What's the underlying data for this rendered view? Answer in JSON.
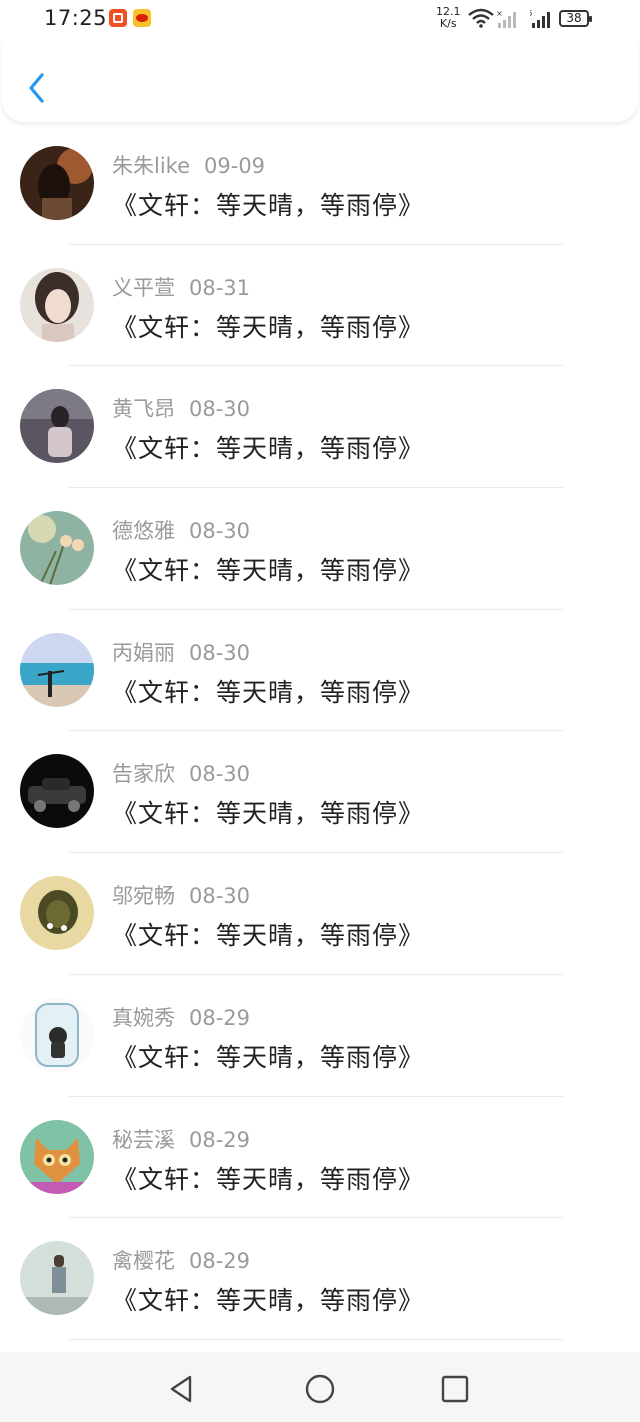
{
  "status_bar": {
    "time": "17:25",
    "net_speed_value": "12.1",
    "net_speed_unit": "K/s",
    "network_label": "46",
    "battery": "38"
  },
  "accent_color": "#2196f3",
  "items": [
    {
      "name": "朱朱like",
      "date": "09-09",
      "title": "《文轩：等天晴，等雨停》"
    },
    {
      "name": "义平萱",
      "date": "08-31",
      "title": "《文轩：等天晴，等雨停》"
    },
    {
      "name": "黄飞昂",
      "date": "08-30",
      "title": "《文轩：等天晴，等雨停》"
    },
    {
      "name": "德悠雅",
      "date": "08-30",
      "title": "《文轩：等天晴，等雨停》"
    },
    {
      "name": "丙娟丽",
      "date": "08-30",
      "title": "《文轩：等天晴，等雨停》"
    },
    {
      "name": "告家欣",
      "date": "08-30",
      "title": "《文轩：等天晴，等雨停》"
    },
    {
      "name": "邬宛畅",
      "date": "08-30",
      "title": "《文轩：等天晴，等雨停》"
    },
    {
      "name": "真婉秀",
      "date": "08-29",
      "title": "《文轩：等天晴，等雨停》"
    },
    {
      "name": "秘芸溪",
      "date": "08-29",
      "title": "《文轩：等天晴，等雨停》"
    },
    {
      "name": "禽樱花",
      "date": "08-29",
      "title": "《文轩：等天晴，等雨停》"
    }
  ],
  "icons": {
    "back": "chevron-left-icon",
    "nav_back": "triangle-back-icon",
    "nav_home": "circle-home-icon",
    "nav_recent": "square-recent-icon"
  }
}
